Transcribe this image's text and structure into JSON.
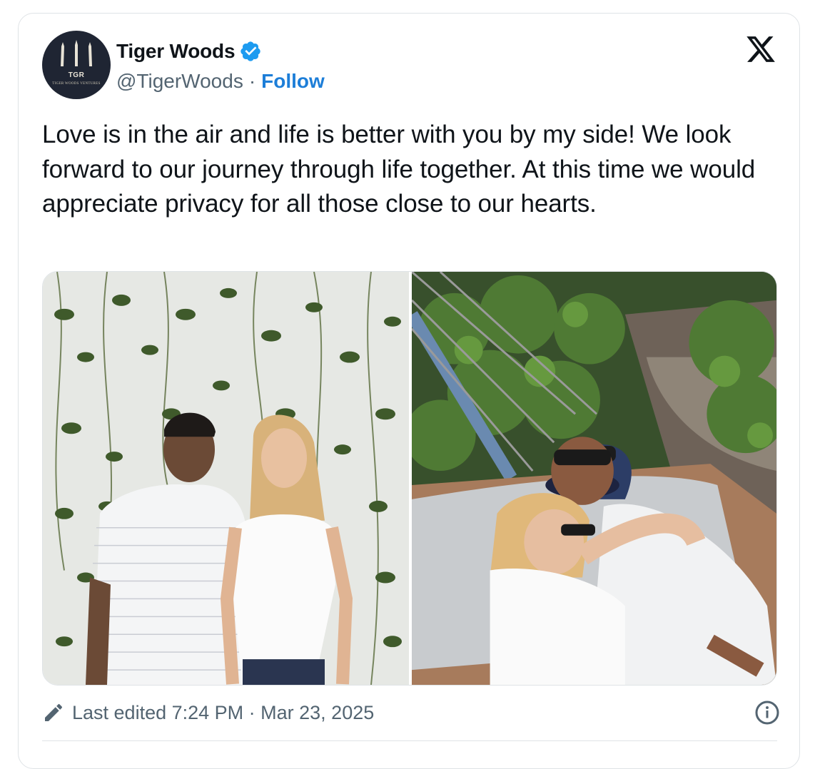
{
  "author": {
    "display_name": "Tiger Woods",
    "handle": "@TigerWoods",
    "separator": "·",
    "follow_label": "Follow",
    "avatar_text": "TGR",
    "avatar_subtext": "TIGER WOODS VENTURES",
    "verified": true
  },
  "tweet": {
    "text": "Love is in the air and life is better with you by my side! We look forward to our journey through life together. At this time we would appreciate privacy for all those close to our hearts."
  },
  "media": {
    "count": 2
  },
  "meta": {
    "edited_label": "Last edited 7:24 PM · Mar 23, 2025"
  },
  "colors": {
    "text": "#0f1419",
    "secondary": "#536471",
    "link": "#1d7ed8",
    "verified": "#1d9bf0",
    "border": "#dfe3e6"
  },
  "icons": {
    "verified": "verified-badge-icon",
    "platform": "x-logo-icon",
    "edit": "pencil-icon",
    "info": "info-icon"
  }
}
